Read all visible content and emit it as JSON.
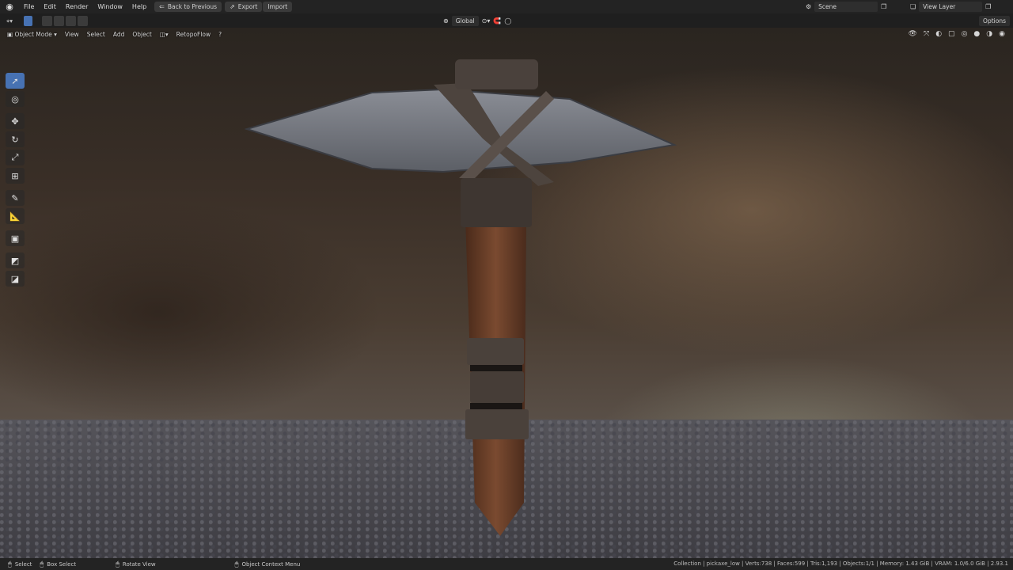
{
  "topbar": {
    "menus": [
      "File",
      "Edit",
      "Render",
      "Window",
      "Help"
    ],
    "back_button": "Back to Previous",
    "export_button": "Export",
    "import_button": "Import",
    "scene_name": "Scene",
    "view_layer_name": "View Layer"
  },
  "header": {
    "transform_orientation": "Global",
    "options_label": "Options"
  },
  "viewport_header": {
    "mode": "Object Mode",
    "menus": [
      "View",
      "Select",
      "Add",
      "Object"
    ],
    "addon": "RetopoFlow"
  },
  "statusbar": {
    "select": "Select",
    "box_select": "Box Select",
    "rotate_view": "Rotate View",
    "context_menu": "Object Context Menu",
    "stats": "Collection | pickaxe_low | Verts:738 | Faces:599 | Tris:1,193 | Objects:1/1 | Memory: 1.43 GiB | VRAM: 1.0/6.0 GiB | 2.93.1"
  }
}
